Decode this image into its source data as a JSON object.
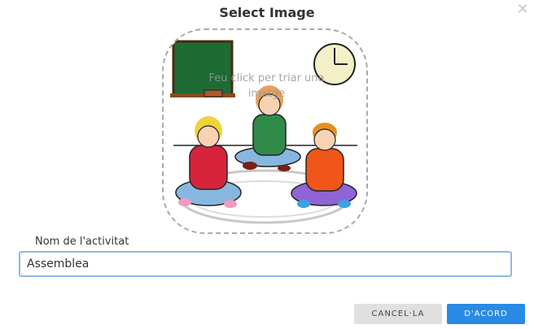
{
  "dialog": {
    "title": "Select Image",
    "close_icon": "close-icon"
  },
  "image_picker": {
    "hint": "Feu click per triar una imatge"
  },
  "activity_name": {
    "label": "Nom de l'activitat",
    "value": "Assemblea"
  },
  "actions": {
    "cancel_label": "CANCEL·LA",
    "ok_label": "D'ACORD"
  },
  "colors": {
    "primary": "#2a8ae6",
    "secondary_button": "#e0e0e0",
    "focus_border": "#8fb8e8"
  }
}
